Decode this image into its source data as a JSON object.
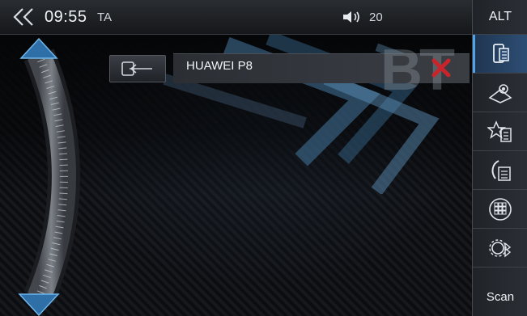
{
  "status_bar": {
    "clock": "09:55",
    "ta_label": "TA",
    "volume": "20"
  },
  "sidebar": {
    "top_label": "ALT",
    "bottom_label": "Scan",
    "items": [
      {
        "name": "phone-contacts-icon",
        "active": true
      },
      {
        "name": "phonebook-icon",
        "active": false
      },
      {
        "name": "favorites-icon",
        "active": false
      },
      {
        "name": "call-log-icon",
        "active": false
      },
      {
        "name": "keypad-icon",
        "active": false
      },
      {
        "name": "bt-settings-icon",
        "active": false
      }
    ]
  },
  "device": {
    "name": "HUAWEI P8",
    "watermark": "BT"
  },
  "colors": {
    "accent": "#4fa3e6",
    "delete": "#c8242c"
  }
}
